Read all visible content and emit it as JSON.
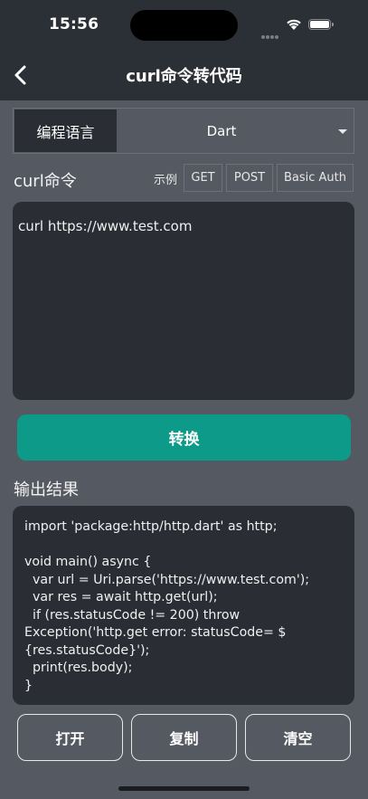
{
  "status_bar": {
    "time": "15:56"
  },
  "nav": {
    "title": "curl命令转代码"
  },
  "language": {
    "label": "编程语言",
    "selected": "Dart"
  },
  "curl_section": {
    "title": "curl命令",
    "examples_label": "示例",
    "examples": [
      "GET",
      "POST",
      "Basic Auth"
    ],
    "command": "curl https://www.test.com"
  },
  "convert_button": "转换",
  "output_section": {
    "title": "输出结果",
    "code_lines": [
      "import 'package:http/http.dart' as http;",
      "",
      "void main() async {",
      "  var url = Uri.parse('https://www.test.com');",
      "  var res = await http.get(url);",
      "  if (res.statusCode != 200) throw",
      "Exception('http.get error: statusCode= $",
      "{res.statusCode}');",
      "  print(res.body);",
      "}"
    ]
  },
  "actions": {
    "open": "打开",
    "copy": "复制",
    "clear": "清空"
  },
  "colors": {
    "accent": "#0e9a88",
    "background": "#555961",
    "panel": "#2a2d33"
  }
}
